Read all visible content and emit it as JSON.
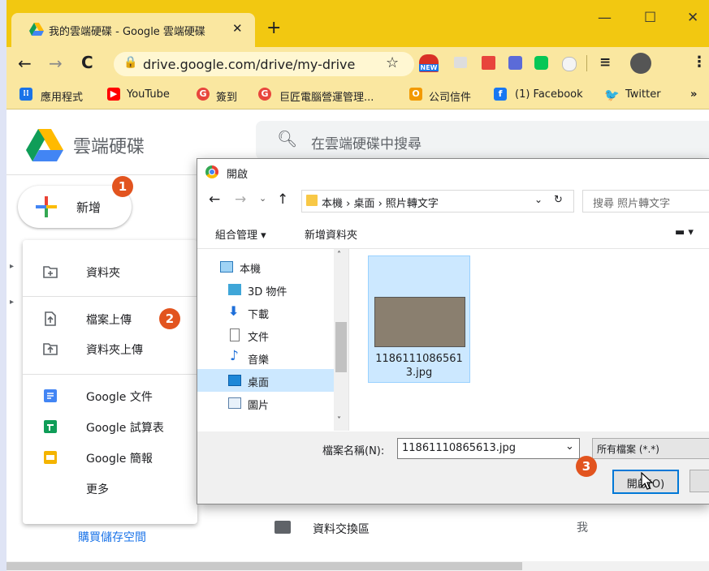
{
  "browser": {
    "tab_title": "我的雲端硬碟 - Google 雲端硬碟",
    "tab_close": "✕",
    "new_tab": "+",
    "url": "drive.google.com/drive/my-drive",
    "ext_new_label": "NEW",
    "bookmarks": [
      "應用程式",
      "YouTube",
      "簽到",
      "巨匠電腦營運管理...",
      "公司信件",
      "(1) Facebook",
      "Twitter",
      "»"
    ]
  },
  "drive": {
    "logo_text": "雲端硬碟",
    "search_placeholder": "在雲端硬碟中搜尋",
    "new_button": "新增",
    "menu": [
      "資料夾",
      "檔案上傳",
      "資料夾上傳",
      "Google 文件",
      "Google 試算表",
      "Google 簡報",
      "更多"
    ],
    "buy_storage": "購買儲存空間",
    "file_row": {
      "name": "資料交換區",
      "owner": "我"
    }
  },
  "badges": [
    "1",
    "2",
    "3"
  ],
  "dialog": {
    "title": "開啟",
    "breadcrumb": "本機 › 桌面 › 照片轉文字",
    "search_placeholder": "搜尋 照片轉文字",
    "organize": "組合管理 ▾",
    "new_folder": "新增資料夾",
    "tree": [
      "本機",
      "3D 物件",
      "下載",
      "文件",
      "音樂",
      "桌面",
      "圖片"
    ],
    "selected_file": "11861110865613.jpg",
    "filename_label": "檔案名稱(N):",
    "filename_value": "11861110865613.jpg",
    "filetype": "所有檔案 (*.*)",
    "open_button": "開啟(O)"
  },
  "colors": {
    "chrome_frame": "#f2c811",
    "accent_badge": "#e2541f",
    "selection": "#cce8ff",
    "link": "#1a73e8"
  }
}
